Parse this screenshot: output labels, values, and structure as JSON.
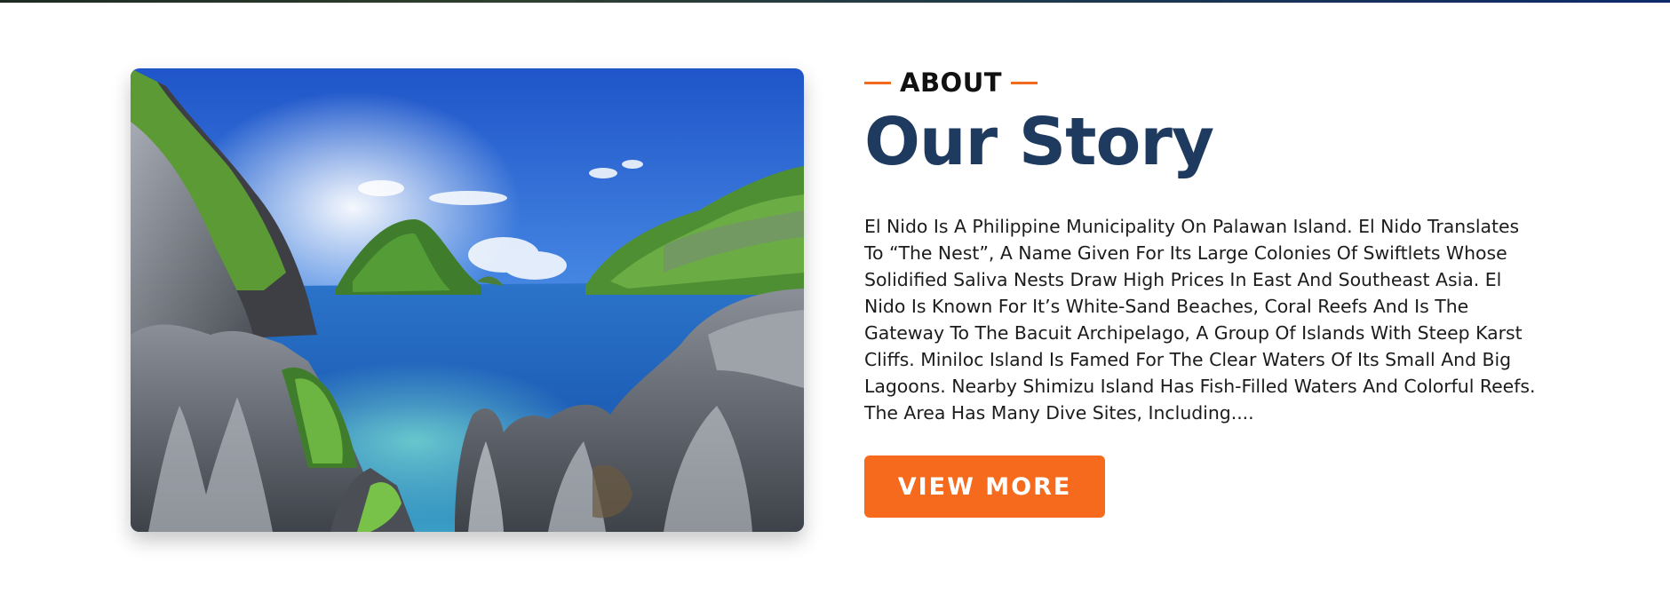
{
  "about": {
    "eyebrow": "ABOUT",
    "title": "Our Story",
    "body": "El Nido Is A Philippine Municipality On Palawan Island. El Nido Translates To “The Nest”, A Name Given For Its Large Colonies Of Swiftlets Whose Solidified Saliva Nests Draw High Prices In East And Southeast Asia. El Nido Is Known For It’s White-Sand Beaches, Coral Reefs And Is The Gateway To The Bacuit Archipelago, A Group Of Islands With Steep Karst Cliffs. Miniloc Island Is Famed For The Clear Waters Of Its Small And Big Lagoons. Nearby Shimizu Island Has Fish-Filled Waters And Colorful Reefs. The Area Has Many Dive Sites, Including....",
    "button_label": "VIEW MORE"
  },
  "colors": {
    "accent": "#f56a1c",
    "heading": "#1e3a5f",
    "text": "#1c1c1c"
  }
}
